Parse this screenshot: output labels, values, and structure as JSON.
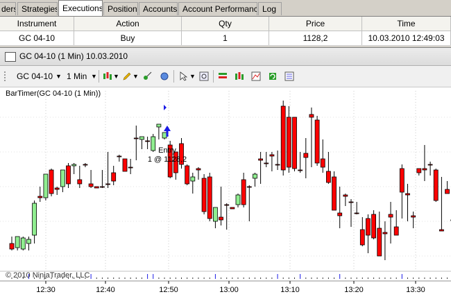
{
  "tabs": [
    {
      "label": "ders",
      "active": false
    },
    {
      "label": "Strategies",
      "active": false
    },
    {
      "label": "Executions",
      "active": true
    },
    {
      "label": "Positions",
      "active": false
    },
    {
      "label": "Accounts",
      "active": false
    },
    {
      "label": "Account Performance",
      "active": false
    },
    {
      "label": "Log",
      "active": false
    }
  ],
  "executions": {
    "columns": [
      "Instrument",
      "Action",
      "Qty",
      "Price",
      "Time"
    ],
    "rows": [
      [
        "GC 04-10",
        "Buy",
        "1",
        "1128,2",
        "10.03.2010 12:49:03"
      ]
    ]
  },
  "chart_window": {
    "title": "GC 04-10 (1 Min)  10.03.2010",
    "toolbar": {
      "instrument": "GC 04-10",
      "interval": "1 Min"
    },
    "indicator_label": "BarTimer(GC 04-10 (1 Min))",
    "copyright": "© 2010 NinjaTrader, LLC",
    "up_color": "#90ee90",
    "down_color": "#ff0000"
  },
  "chart_data": {
    "type": "candlestick",
    "x_tick_labels": [
      "12:30",
      "12:40",
      "12:50",
      "13:00",
      "13:10",
      "13:20",
      "13:30"
    ],
    "annotations": [
      {
        "text": "Entry",
        "detail": "1 @ 1128,2",
        "marker": "up-arrow"
      }
    ],
    "grid": true
  }
}
